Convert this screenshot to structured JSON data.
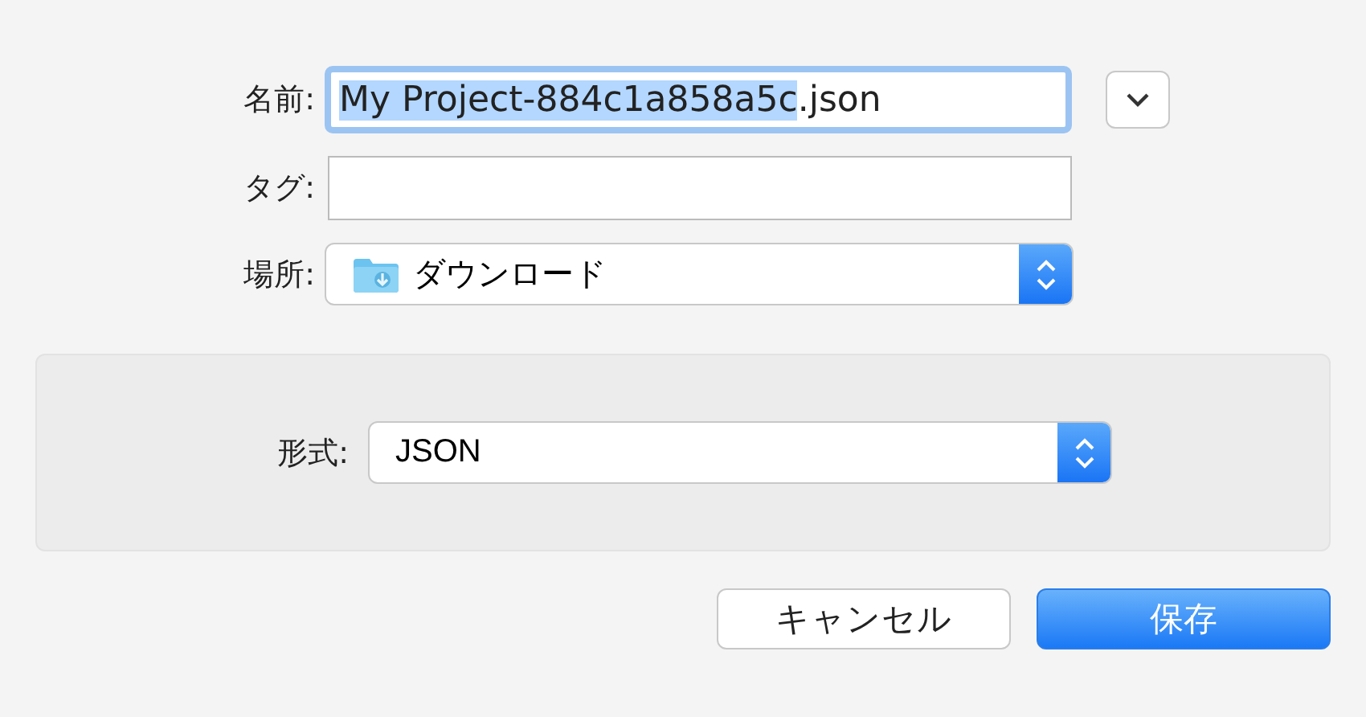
{
  "name_field": {
    "label": "名前:",
    "selected_text": "My Project-884c1a858a5c",
    "rest_text": ".json",
    "focused": true
  },
  "tags_field": {
    "label": "タグ:"
  },
  "location": {
    "label": "場所:",
    "value": "ダウンロード"
  },
  "format": {
    "label": "形式:",
    "value": "JSON"
  },
  "buttons": [
    {
      "label": "キャンセル",
      "kind": "secondary"
    },
    {
      "label": "保存",
      "kind": "primary"
    }
  ]
}
